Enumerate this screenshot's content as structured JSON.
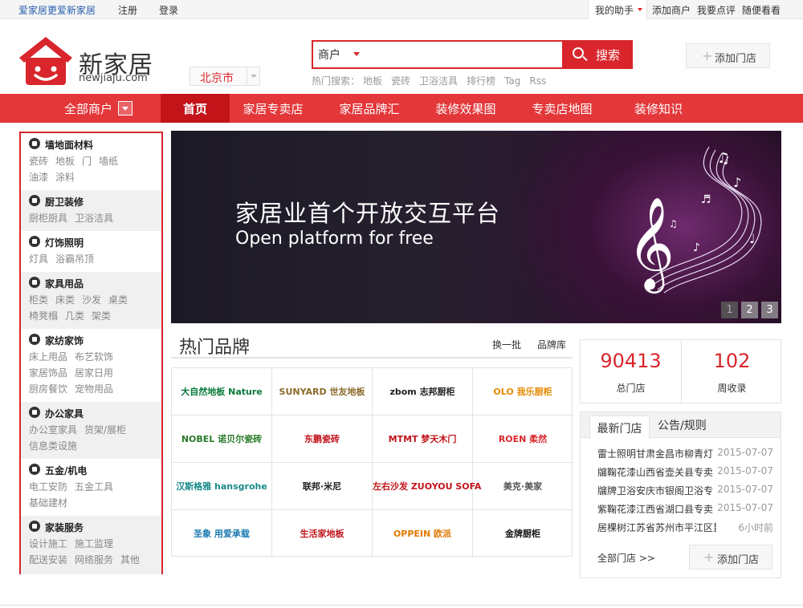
{
  "topbar": {
    "slogan": "爱家居更爱新家居",
    "register": "注册",
    "login": "登录",
    "helper": "我的助手",
    "links": [
      "添加商户",
      "我要点评",
      "随便看看"
    ]
  },
  "header": {
    "logo_text": "新家居",
    "logo_url": "newjiaju.com",
    "city": "北京市",
    "search": {
      "type": "商户",
      "value": "",
      "button": "搜索",
      "hot_label": "热门搜索：",
      "hot_items": [
        "地板",
        "瓷砖",
        "卫浴洁具",
        "排行榜",
        "Tag",
        "Rss"
      ]
    },
    "add_store": "添加门店"
  },
  "nav": {
    "all_merchants": "全部商户",
    "items": [
      "首页",
      "家居专卖店",
      "家居品牌汇",
      "装修效果图",
      "专卖店地图",
      "装修知识"
    ],
    "active_index": 0
  },
  "sidebar": {
    "categories": [
      {
        "title": "墙地面材料",
        "lines": [
          [
            "瓷砖",
            "地板",
            "门",
            "墙纸"
          ],
          [
            "油漆",
            "涂料"
          ]
        ]
      },
      {
        "title": "厨卫装修",
        "lines": [
          [
            "厨柜厨具",
            "卫浴洁具"
          ]
        ]
      },
      {
        "title": "灯饰照明",
        "lines": [
          [
            "灯具",
            "浴霸吊顶"
          ]
        ]
      },
      {
        "title": "家具用品",
        "lines": [
          [
            "柜类",
            "床类",
            "沙发",
            "桌类"
          ],
          [
            "椅凳榻",
            "几类",
            "架类"
          ]
        ]
      },
      {
        "title": "家纺家饰",
        "lines": [
          [
            "床上用品",
            "布艺软饰"
          ],
          [
            "家居饰品",
            "居家日用"
          ],
          [
            "厨房餐饮",
            "宠物用品"
          ]
        ]
      },
      {
        "title": "办公家具",
        "lines": [
          [
            "办公室家具",
            "货架/展柜"
          ],
          [
            "信息类设施"
          ]
        ]
      },
      {
        "title": "五金/机电",
        "lines": [
          [
            "电工安防",
            "五金工具"
          ],
          [
            "基础建材"
          ]
        ]
      },
      {
        "title": "家装服务",
        "lines": [
          [
            "设计施工",
            "施工监理"
          ],
          [
            "配送安装",
            "网络服务",
            "其他"
          ]
        ]
      }
    ]
  },
  "banner": {
    "title": "家居业首个开放交互平台",
    "subtitle": "Open platform for free",
    "pages": [
      "1",
      "2",
      "3"
    ],
    "current_page": 1
  },
  "hot_brands": {
    "title": "热门品牌",
    "change": "换一批",
    "library": "品牌库",
    "brands": [
      {
        "name": "大自然地板 Nature",
        "color": "#0a7a3a"
      },
      {
        "name": "SUNYARD 世友地板",
        "color": "#8a6a2a"
      },
      {
        "name": "zbom 志邦厨柜",
        "color": "#222222"
      },
      {
        "name": "OLO 我乐厨柜",
        "color": "#e58a00"
      },
      {
        "name": "NOBEL 诺贝尔瓷砖",
        "color": "#2a7a2a"
      },
      {
        "name": "东鹏瓷砖",
        "color": "#c0141a"
      },
      {
        "name": "MTMT 梦天木门",
        "color": "#c0141a"
      },
      {
        "name": "ROEN 柔然",
        "color": "#d9262c"
      },
      {
        "name": "汉斯格雅 hansgrohe",
        "color": "#1a8a8a"
      },
      {
        "name": "联邦·米尼",
        "color": "#222222"
      },
      {
        "name": "左右沙发 ZUOYOU SOFA",
        "color": "#c0141a"
      },
      {
        "name": "美克·美家",
        "color": "#555555"
      },
      {
        "name": "圣象 用爱承载",
        "color": "#1a7ab0"
      },
      {
        "name": "生活家地板",
        "color": "#c0141a"
      },
      {
        "name": "OPPEIN 欧派",
        "color": "#e07a00"
      },
      {
        "name": "金牌厨柜",
        "color": "#111111"
      }
    ]
  },
  "stats": [
    {
      "value": "90413",
      "label": "总门店"
    },
    {
      "value": "102",
      "label": "周收录"
    }
  ],
  "news": {
    "tabs": [
      "最新门店",
      "公告/规则"
    ],
    "items": [
      {
        "title": "雷士照明甘肃金昌市柳青灯",
        "date": "2015-07-07"
      },
      {
        "title": "牖鞠花漆山西省壶关县专卖",
        "date": "2015-07-07"
      },
      {
        "title": "牖牌卫浴安庆市银阁卫浴专",
        "date": "2015-07-07"
      },
      {
        "title": "紫鞠花漆江西省湖口县专卖",
        "date": "2015-07-07"
      },
      {
        "title": "居棵树江苏省苏州市平江区昆山...",
        "date": "6小时前"
      }
    ],
    "more": "全部门店 >>",
    "add_store": "添加门店"
  }
}
